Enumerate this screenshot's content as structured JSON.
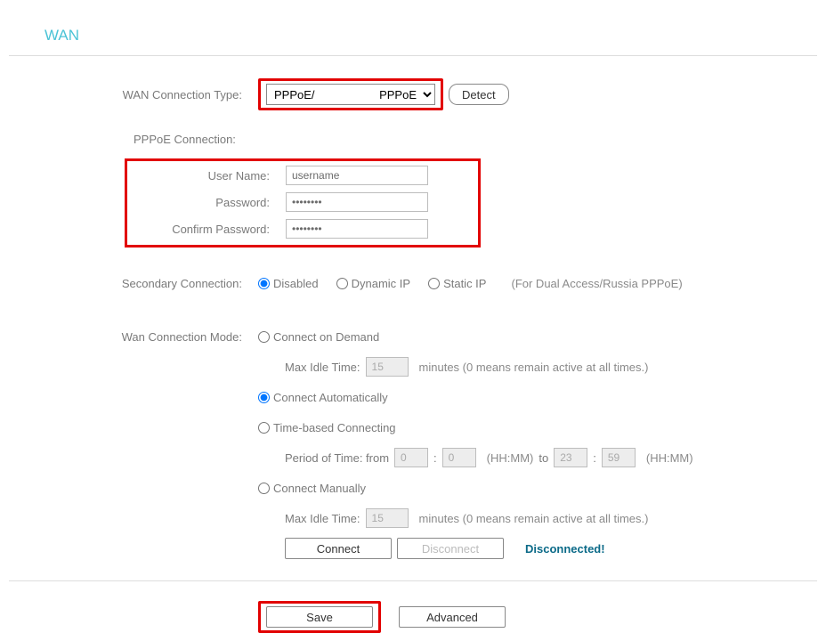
{
  "title": "WAN",
  "wan_type": {
    "label": "WAN Connection Type:",
    "selected": "PPPoE/        PPPoE",
    "detect_btn": "Detect"
  },
  "pppoe_header": "PPPoE Connection:",
  "pppoe": {
    "username_label": "User Name:",
    "username_value": "username",
    "password_label": "Password:",
    "password_value": "••••••••",
    "confirm_label": "Confirm Password:",
    "confirm_value": "••••••••"
  },
  "secondary": {
    "label": "Secondary Connection:",
    "opt_disabled": "Disabled",
    "opt_dynamic": "Dynamic IP",
    "opt_static": "Static IP",
    "note": "(For Dual Access/Russia PPPoE)"
  },
  "mode": {
    "label": "Wan Connection Mode:",
    "on_demand": "Connect on Demand",
    "max_idle_label": "Max Idle Time:",
    "max_idle_value_1": "15",
    "idle_hint": "minutes (0 means remain active at all times.)",
    "auto": "Connect Automatically",
    "time_based": "Time-based Connecting",
    "period_label": "Period of Time: from",
    "hh1": "0",
    "mm1": "0",
    "hh2": "23",
    "mm2": "59",
    "hhmm": "(HH:MM)",
    "to": "to",
    "manual": "Connect Manually",
    "max_idle_value_2": "15",
    "connect_btn": "Connect",
    "disconnect_btn": "Disconnect",
    "status": "Disconnected!"
  },
  "footer": {
    "save_btn": "Save",
    "advanced_btn": "Advanced"
  }
}
